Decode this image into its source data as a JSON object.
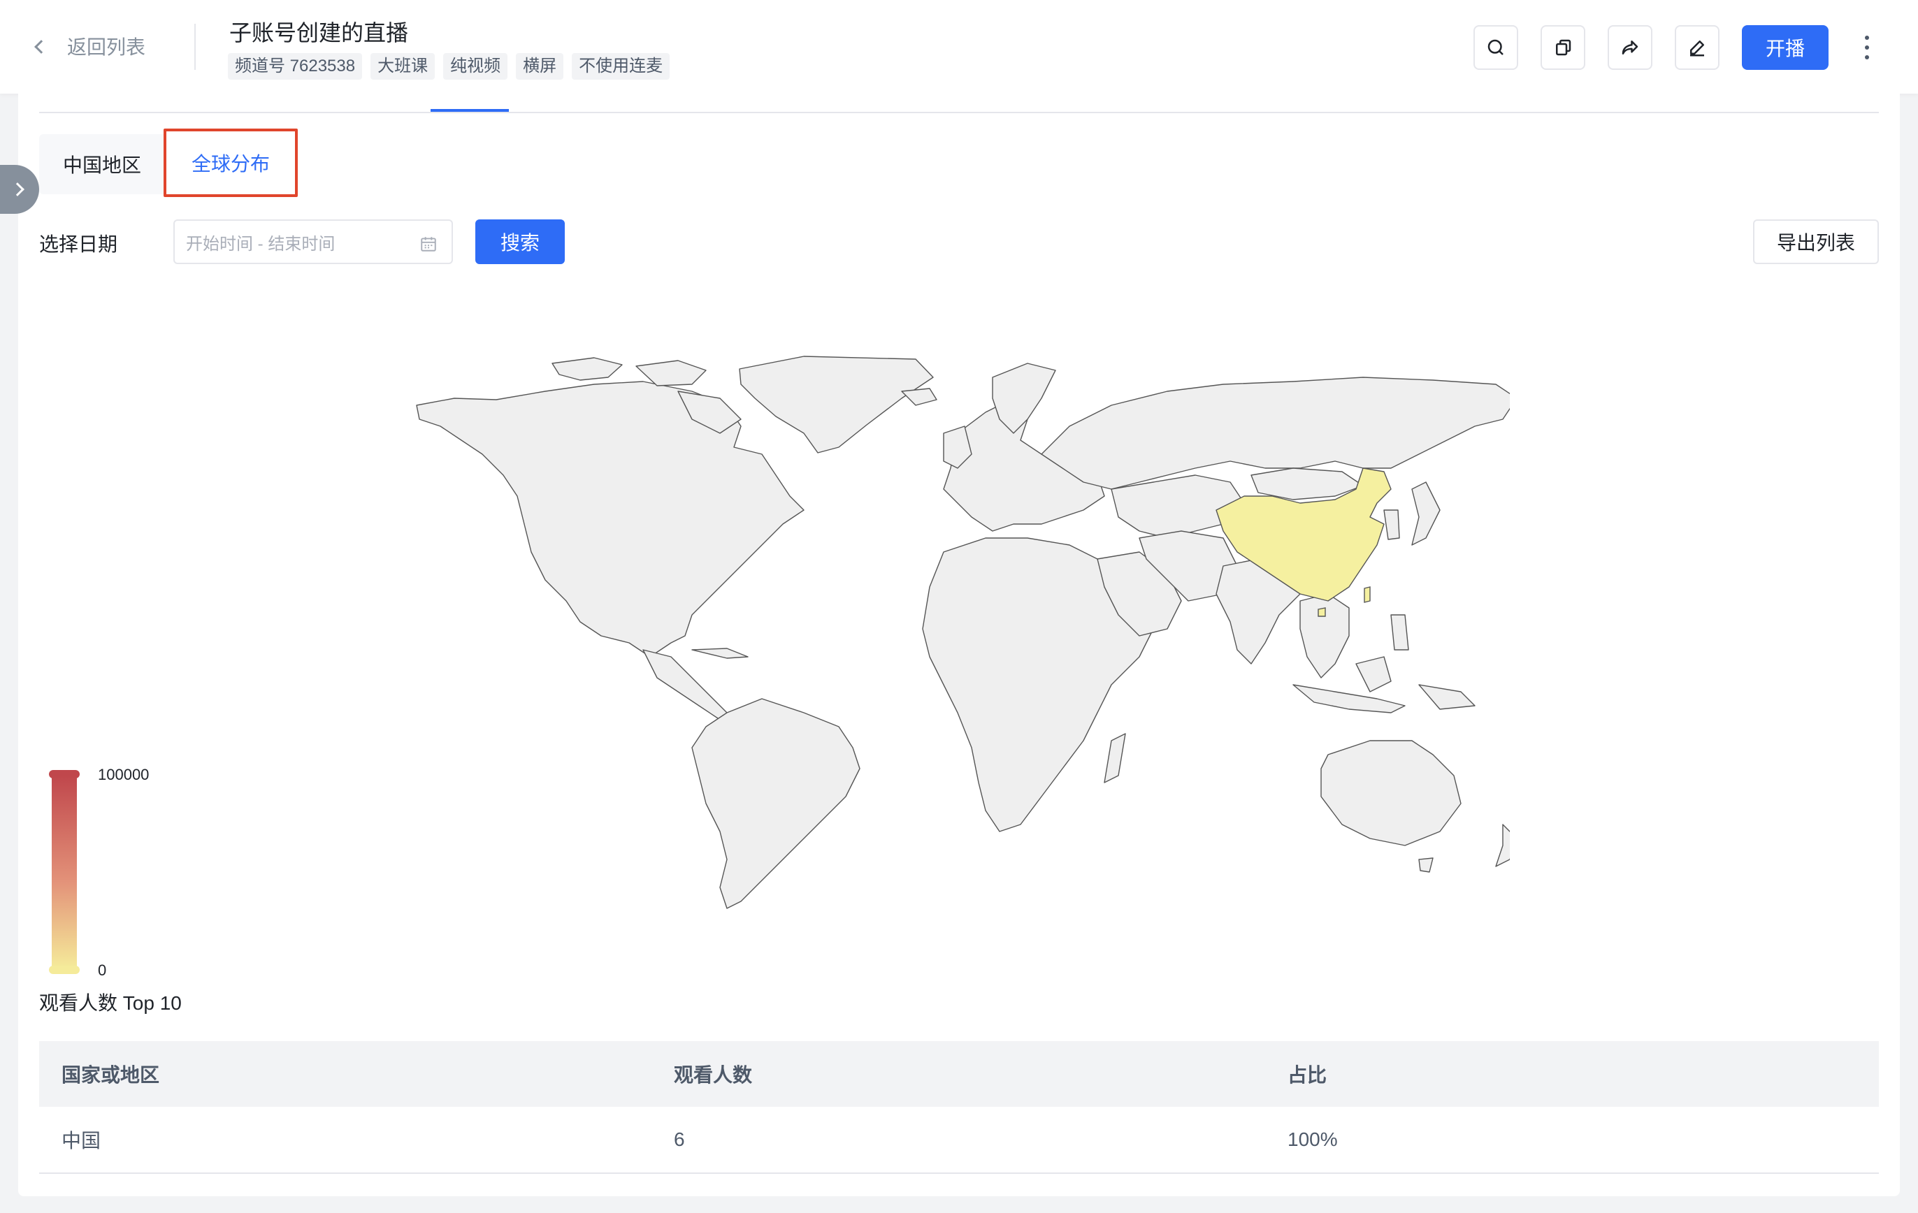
{
  "header": {
    "back_label": "返回列表",
    "title": "子账号创建的直播",
    "tags": [
      "频道号 7623538",
      "大班课",
      "纯视频",
      "横屏",
      "不使用连麦"
    ],
    "start_label": "开播"
  },
  "region_tabs": {
    "china": "中国地区",
    "global": "全球分布",
    "selected": "global"
  },
  "filter": {
    "label": "选择日期",
    "date_placeholder": "开始时间 - 结束时间",
    "search_label": "搜索",
    "export_label": "导出列表"
  },
  "map": {
    "highlighted_country": "中国",
    "highlight_color": "#f5f0a0",
    "default_color": "#efefef",
    "legend": {
      "max": "100000",
      "min": "0",
      "color_high": "#c0474c",
      "color_low": "#f5eb9a"
    }
  },
  "table": {
    "title": "观看人数 Top 10",
    "headers": [
      "国家或地区",
      "观看人数",
      "占比"
    ],
    "rows": [
      [
        "中国",
        "6",
        "100%"
      ]
    ]
  }
}
